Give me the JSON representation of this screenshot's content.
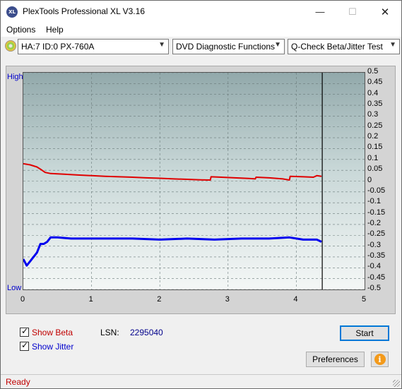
{
  "window": {
    "title": "PlexTools Professional XL V3.16",
    "icon_text": "XL",
    "controls": {
      "minimize": "—",
      "maximize": "☐",
      "close": "✕"
    }
  },
  "menu": [
    {
      "label": "Options",
      "hotkey": "O"
    },
    {
      "label": "Help",
      "hotkey": "H"
    }
  ],
  "toolbar": {
    "drive": "HA:7 ID:0  PX-760A",
    "function": "DVD Diagnostic Functions",
    "test": "Q-Check Beta/Jitter Test"
  },
  "chart": {
    "high_label": "High",
    "low_label": "Low",
    "y_ticks": [
      "0.5",
      "0.45",
      "0.4",
      "0.35",
      "0.3",
      "0.25",
      "0.2",
      "0.15",
      "0.1",
      "0.05",
      "0",
      "-0.05",
      "-0.1",
      "-0.15",
      "-0.2",
      "-0.25",
      "-0.3",
      "-0.35",
      "-0.4",
      "-0.45",
      "-0.5"
    ],
    "x_ticks": [
      "0",
      "1",
      "2",
      "3",
      "4",
      "5"
    ]
  },
  "chart_data": {
    "type": "line",
    "xlim": [
      0,
      5
    ],
    "ylim": [
      -0.5,
      0.5
    ],
    "grid": true,
    "cursor_x": 4.38,
    "series": [
      {
        "key": "beta",
        "color": "#e00000",
        "x": [
          0,
          0.1,
          0.2,
          0.25,
          0.32,
          0.4,
          0.6,
          0.8,
          1.0,
          1.2,
          1.4,
          1.6,
          1.8,
          2.0,
          2.2,
          2.4,
          2.6,
          2.74,
          2.75,
          2.9,
          3.1,
          3.3,
          3.4,
          3.41,
          3.6,
          3.8,
          3.9,
          3.91,
          4.1,
          4.25,
          4.3,
          4.37
        ],
        "y": [
          0.08,
          0.075,
          0.065,
          0.055,
          0.04,
          0.035,
          0.032,
          0.028,
          0.025,
          0.022,
          0.02,
          0.018,
          0.015,
          0.013,
          0.01,
          0.008,
          0.006,
          0.005,
          0.02,
          0.018,
          0.015,
          0.012,
          0.01,
          0.018,
          0.015,
          0.01,
          0.005,
          0.022,
          0.02,
          0.018,
          0.025,
          0.022
        ]
      },
      {
        "key": "jitter",
        "color": "#0000ee",
        "x": [
          0,
          0.05,
          0.1,
          0.15,
          0.2,
          0.25,
          0.3,
          0.35,
          0.4,
          0.5,
          0.7,
          1.0,
          1.3,
          1.6,
          2.0,
          2.4,
          2.8,
          3.2,
          3.6,
          3.9,
          4.1,
          4.3,
          4.37
        ],
        "y": [
          -0.36,
          -0.39,
          -0.37,
          -0.35,
          -0.33,
          -0.29,
          -0.29,
          -0.28,
          -0.26,
          -0.26,
          -0.265,
          -0.265,
          -0.265,
          -0.265,
          -0.27,
          -0.265,
          -0.27,
          -0.265,
          -0.265,
          -0.26,
          -0.27,
          -0.27,
          -0.28
        ]
      }
    ]
  },
  "options": {
    "show_beta": {
      "label": "Show Beta",
      "checked": true,
      "check": "✓"
    },
    "show_jitter": {
      "label": "Show Jitter",
      "checked": true,
      "check": "✓"
    }
  },
  "lsn": {
    "label": "LSN:",
    "value": "2295040"
  },
  "buttons": {
    "start": "Start",
    "preferences": "Preferences",
    "info": "i"
  },
  "status": "Ready"
}
